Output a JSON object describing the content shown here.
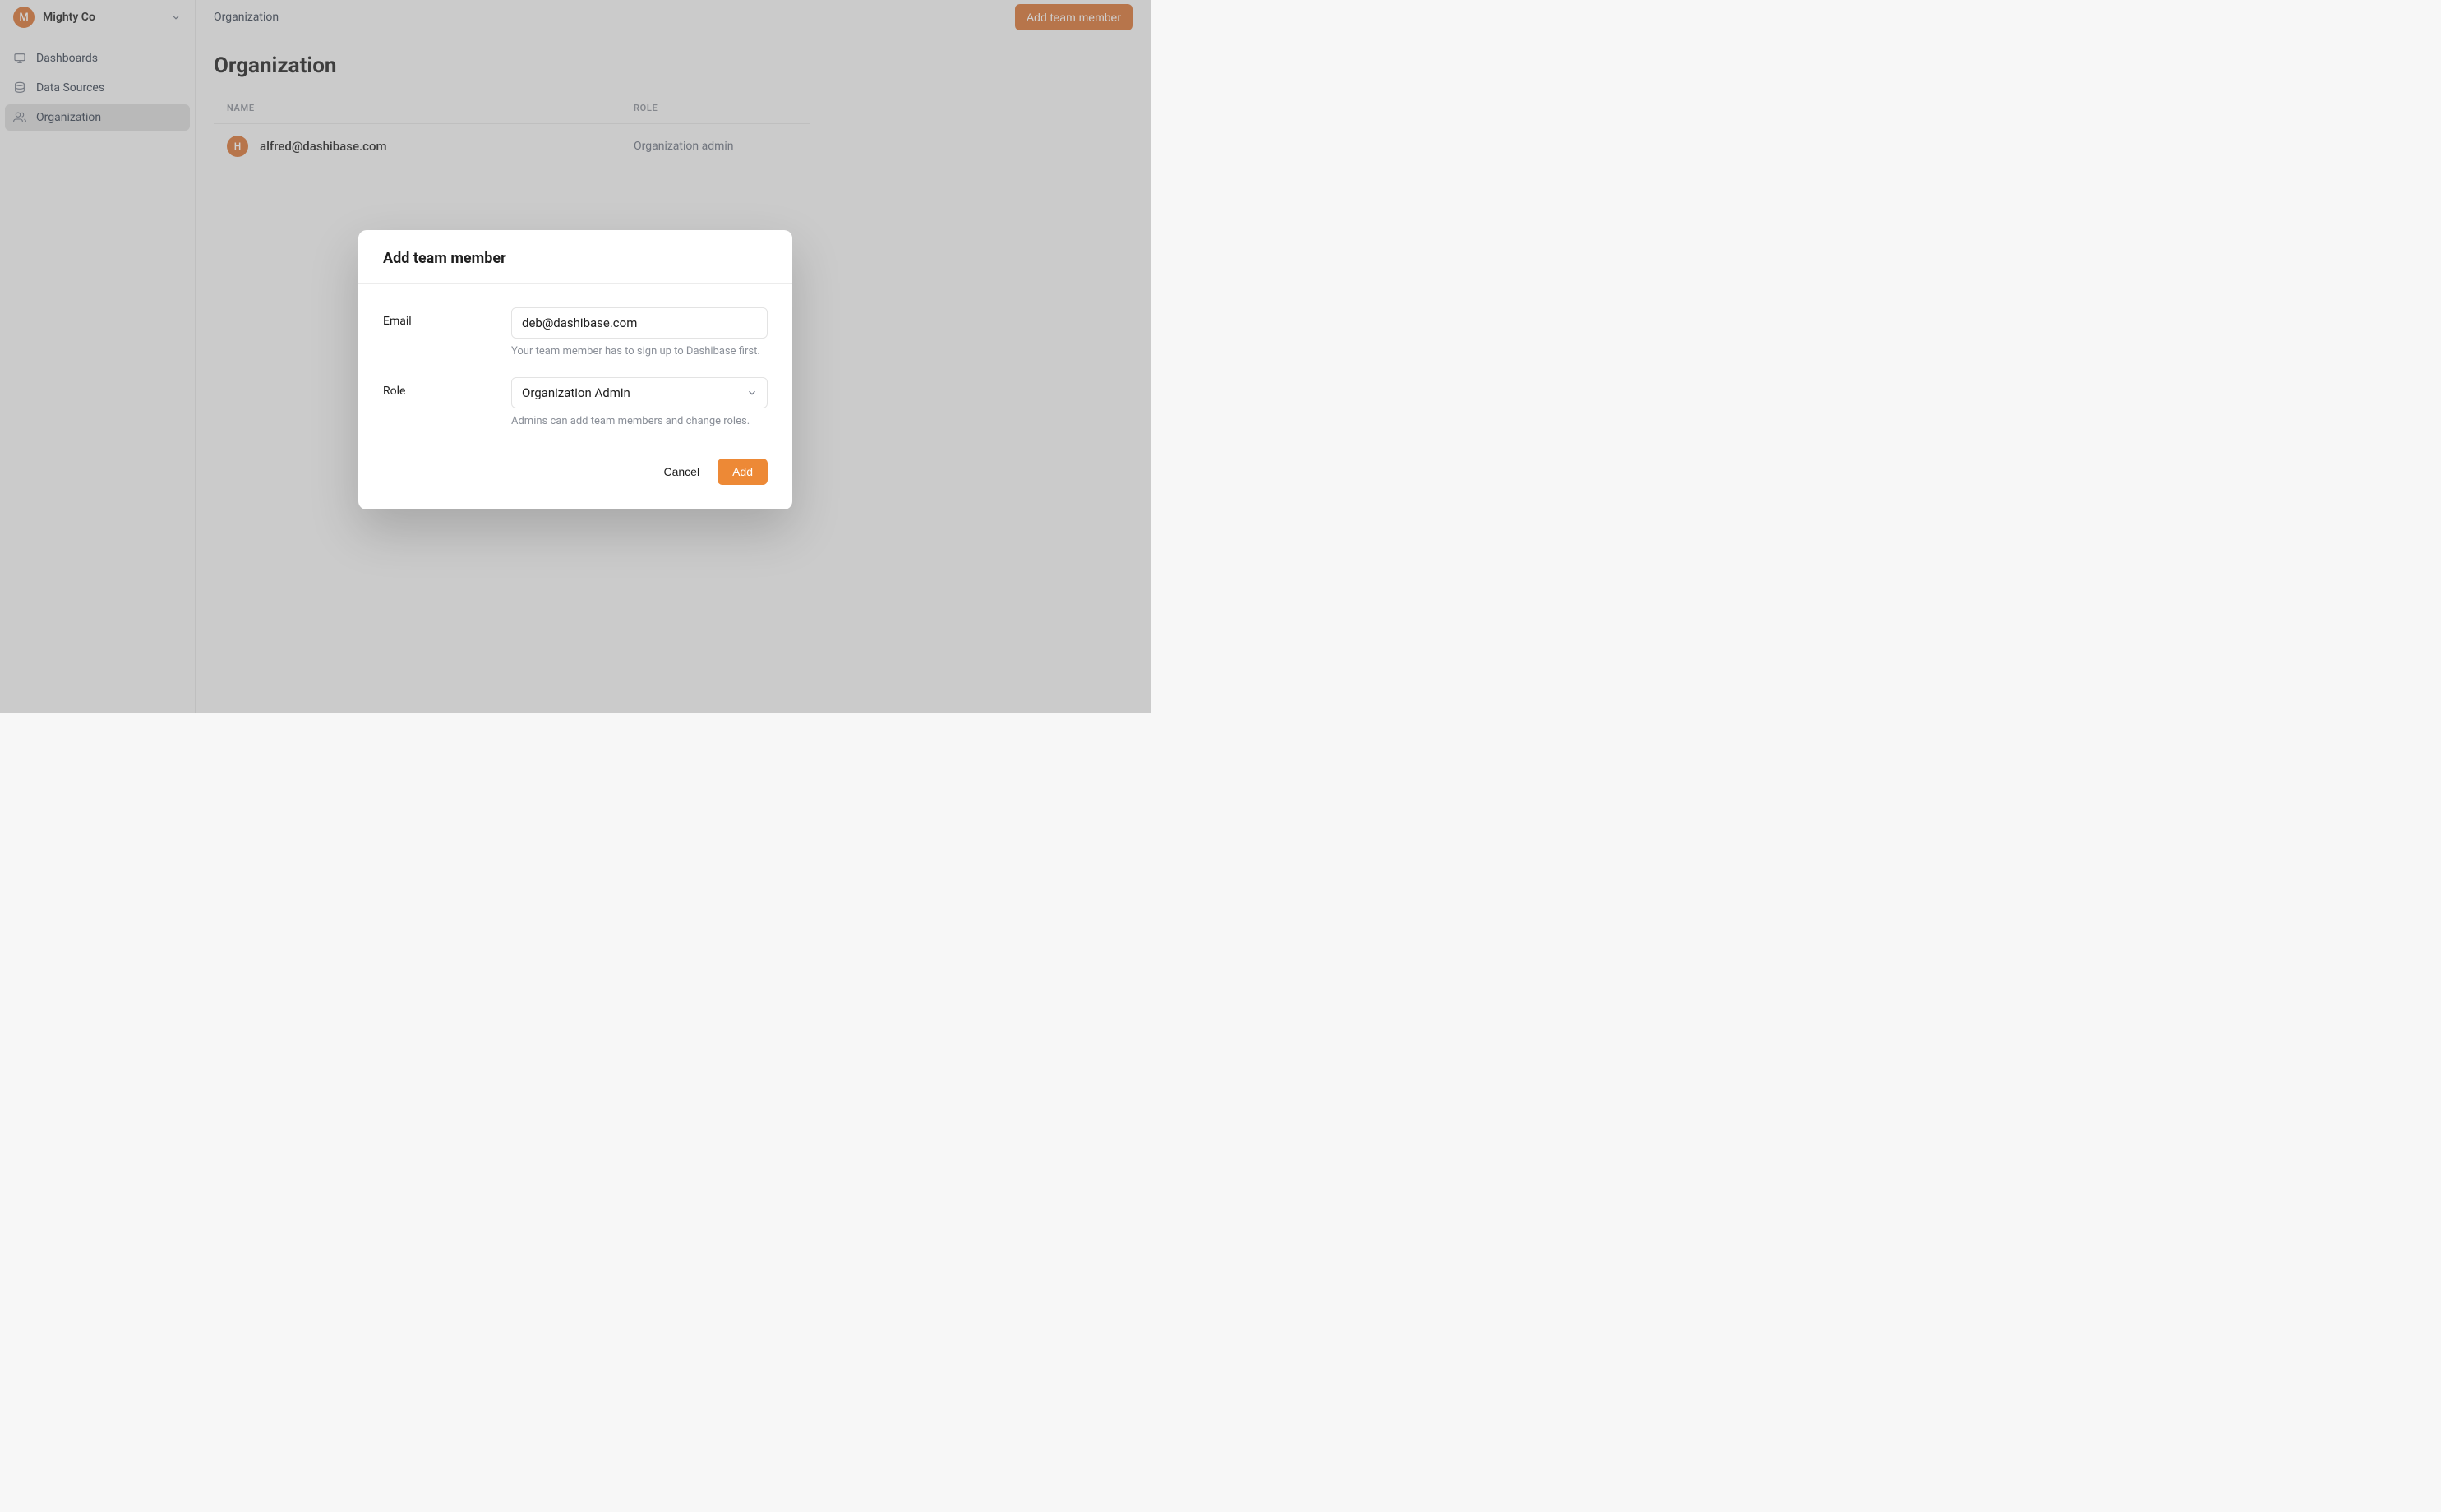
{
  "sidebar": {
    "org_avatar_letter": "M",
    "org_name": "Mighty Co",
    "items": [
      {
        "label": "Dashboards"
      },
      {
        "label": "Data Sources"
      },
      {
        "label": "Organization"
      }
    ]
  },
  "topbar": {
    "breadcrumb": "Organization",
    "add_button_label": "Add team member"
  },
  "page": {
    "title": "Organization",
    "columns": {
      "name": "NAME",
      "role": "ROLE"
    },
    "members": [
      {
        "avatar_letter": "H",
        "email": "alfred@dashibase.com",
        "role": "Organization admin"
      }
    ]
  },
  "modal": {
    "title": "Add team member",
    "email_label": "Email",
    "email_value": "deb@dashibase.com",
    "email_hint": "Your team member has to sign up to Dashibase first.",
    "role_label": "Role",
    "role_value": "Organization Admin",
    "role_hint": "Admins can add team members and change roles.",
    "cancel_label": "Cancel",
    "add_label": "Add"
  }
}
